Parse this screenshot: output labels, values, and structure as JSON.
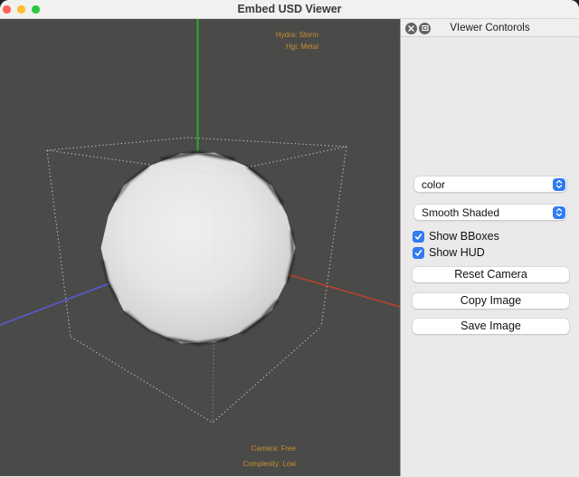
{
  "window": {
    "title": "Embed USD Viewer"
  },
  "viewport": {
    "hud_top": [
      "Hydra: Storm",
      "Hgi: Metal"
    ],
    "hud_bottom": [
      "Camera: Free",
      "Complexity: Low"
    ]
  },
  "panel": {
    "title": "VIewer Contorols",
    "combos": [
      {
        "value": "color"
      },
      {
        "value": "Smooth Shaded"
      }
    ],
    "checkboxes": [
      {
        "label": "Show BBoxes",
        "checked": true
      },
      {
        "label": "Show HUD",
        "checked": true
      }
    ],
    "buttons": [
      {
        "label": "Reset Camera"
      },
      {
        "label": "Copy Image"
      },
      {
        "label": "Save Image"
      }
    ]
  },
  "colors": {
    "accent_blue": "#2f7cf5",
    "viewport_bg": "#4a4a48",
    "titlebar_bg": "#f1f1ef",
    "panel_bg": "#eaeaea",
    "hud_orange": "#c9902e",
    "axis_green": "#2fa32f",
    "axis_red": "#b8432f",
    "axis_blue": "#5858cf",
    "bbox_line": "#d4d4d4",
    "traffic_red": "#ff5f57",
    "traffic_yellow": "#febc2e",
    "traffic_green": "#28c840"
  }
}
